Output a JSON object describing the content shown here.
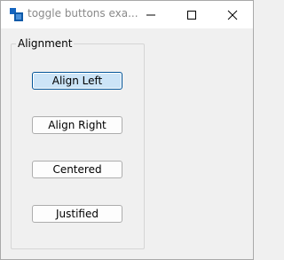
{
  "window": {
    "title": "toggle buttons exa...",
    "icon": "app-window-icon",
    "controls": {
      "minimize": "minimize-icon",
      "maximize": "maximize-icon",
      "close": "close-icon"
    }
  },
  "group": {
    "label": "Alignment",
    "buttons": [
      {
        "label": "Align Left",
        "checked": true
      },
      {
        "label": "Align Right",
        "checked": false
      },
      {
        "label": "Centered",
        "checked": false
      },
      {
        "label": "Justified",
        "checked": false
      }
    ]
  },
  "colors": {
    "checked_fill": "#cce4f7",
    "checked_border": "#005499",
    "app_icon": "#0f5aa8"
  }
}
